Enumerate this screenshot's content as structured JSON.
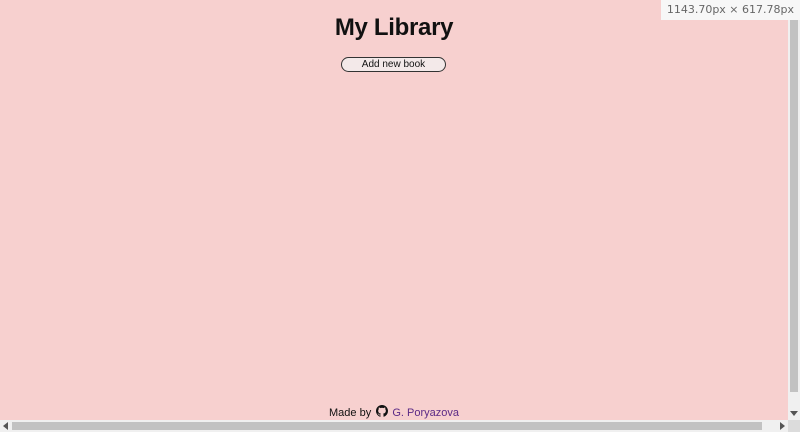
{
  "page": {
    "title": "My Library",
    "background_color": "#f7d0cf"
  },
  "toolbar": {
    "add_book_label": "Add new book"
  },
  "footer": {
    "made_by_label": "Made by",
    "github_icon": "github-icon",
    "author_link_text": "G. Poryazova",
    "link_color": "#5b2a86"
  },
  "viewport_badge": {
    "text": "1143.70px × 617.78px"
  }
}
